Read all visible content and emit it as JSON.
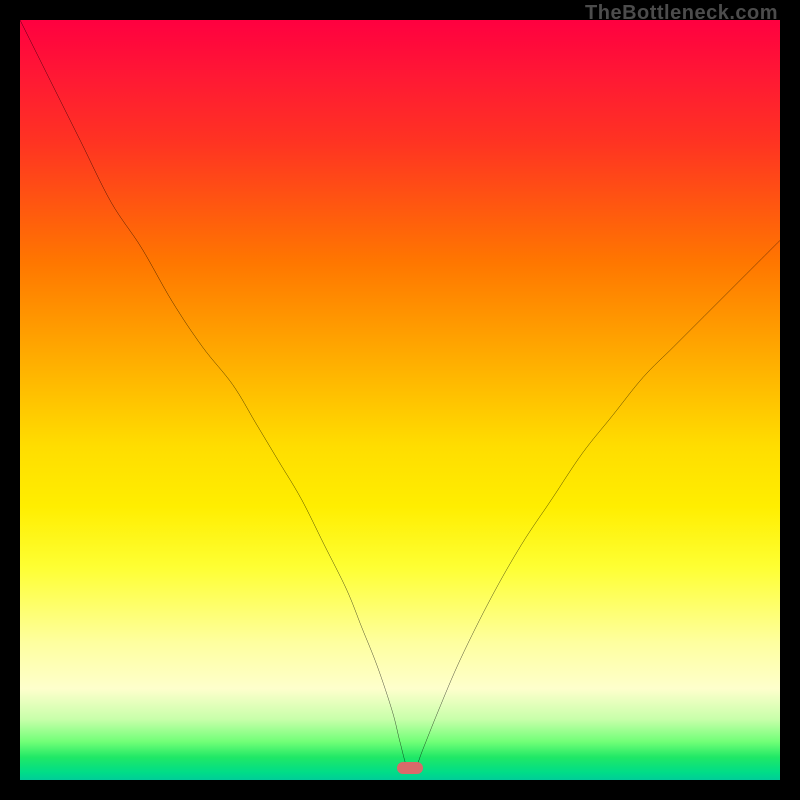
{
  "watermark": "TheBottleneck.com",
  "marker": {
    "color": "#d86a6a",
    "x_pct": 51.3,
    "y_pct": 98.4
  },
  "chart_data": {
    "type": "line",
    "title": "",
    "xlabel": "",
    "ylabel": "",
    "xlim": [
      0,
      100
    ],
    "ylim": [
      0,
      100
    ],
    "x": [
      0,
      4,
      8,
      12,
      16,
      20,
      24,
      28,
      31,
      34,
      37,
      40,
      43,
      45,
      47,
      49,
      50,
      51,
      52,
      53,
      55,
      58,
      62,
      66,
      70,
      74,
      78,
      82,
      86,
      90,
      94,
      98,
      100
    ],
    "values": [
      100,
      92,
      84,
      76,
      70,
      63,
      57,
      52,
      47,
      42,
      37,
      31,
      25,
      20,
      15,
      9,
      5,
      1.5,
      1.5,
      4,
      9,
      16,
      24,
      31,
      37,
      43,
      48,
      53,
      57,
      61,
      65,
      69,
      71
    ],
    "grid": false,
    "legend": false,
    "background_gradient": {
      "top_color": "#ff0040",
      "bottom_color": "#00cc99",
      "stops": [
        "red",
        "orange",
        "yellow",
        "pale-yellow",
        "green",
        "teal"
      ]
    }
  }
}
